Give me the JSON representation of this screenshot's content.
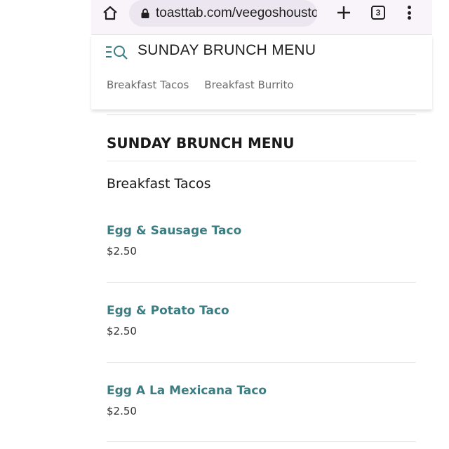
{
  "browser": {
    "url": "toasttab.com/veegoshousto",
    "tab_count": "3",
    "icons": [
      "home-icon",
      "lock-icon",
      "plus-icon",
      "tab-switcher-icon",
      "more-vert-icon"
    ]
  },
  "header": {
    "title": "SUNDAY BRUNCH MENU",
    "icon": "menu-search-icon",
    "categories": [
      {
        "label": "Breakfast Tacos"
      },
      {
        "label": "Breakfast Burrito"
      }
    ]
  },
  "main": {
    "section_title": "SUNDAY BRUNCH MENU",
    "category_heading": "Breakfast Tacos",
    "items": [
      {
        "name": "Egg & Sausage Taco",
        "price": "$2.50"
      },
      {
        "name": "Egg & Potato Taco",
        "price": "$2.50"
      },
      {
        "name": "Egg A La Mexicana Taco",
        "price": "$2.50"
      }
    ]
  },
  "colors": {
    "accent": "#3b7d82",
    "chrome_bg": "#f8f4f9",
    "url_bar_bg": "#ece6f0"
  }
}
